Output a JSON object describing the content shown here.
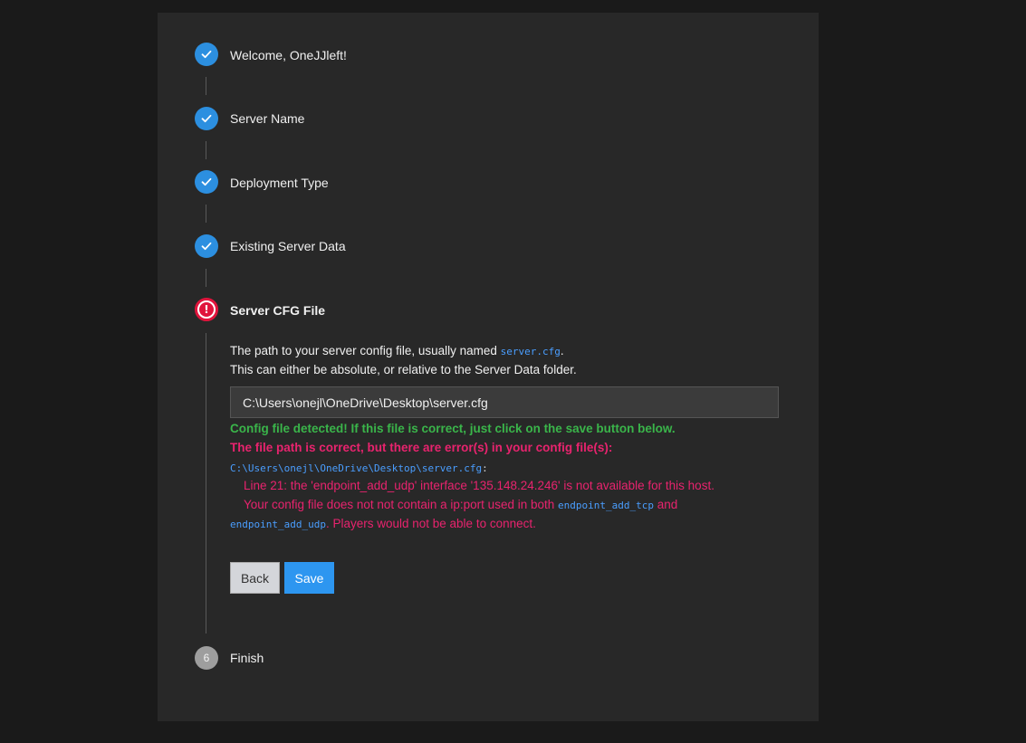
{
  "steps": [
    {
      "label": "Welcome, OneJJleft!",
      "status": "done"
    },
    {
      "label": "Server Name",
      "status": "done"
    },
    {
      "label": "Deployment Type",
      "status": "done"
    },
    {
      "label": "Existing Server Data",
      "status": "done"
    },
    {
      "label": "Server CFG File",
      "status": "error"
    },
    {
      "label": "Finish",
      "status": "pending",
      "number": "6"
    }
  ],
  "cfg": {
    "desc_prefix": "The path to your server config file, usually named ",
    "desc_code": "server.cfg",
    "desc_suffix": ".",
    "desc_line2": "This can either be absolute, or relative to the Server Data folder.",
    "path_value": "C:\\Users\\onejl\\OneDrive\\Desktop\\server.cfg",
    "ok_message": "Config file detected! If this file is correct, just click on the save button below.",
    "error_heading": "The file path is correct, but there are error(s) in your config file(s):",
    "error_file": "C:\\Users\\onejl\\OneDrive\\Desktop\\server.cfg",
    "error_file_suffix": ":",
    "error1": "Line 21: the 'endpoint_add_udp' interface '135.148.24.246' is not available for this host.",
    "error2_prefix": "Your config file does not not contain a ip:port used in both ",
    "error2_code1": "endpoint_add_tcp",
    "error2_mid": " and",
    "error2_code2": "endpoint_add_udp",
    "error2_suffix": ". Players would not be able to connect.",
    "back_label": "Back",
    "save_label": "Save"
  },
  "colors": {
    "done": "#2c8fe0",
    "error": "#e0143c",
    "ok_text": "#3ab54a",
    "error_text": "#e8236e",
    "code": "#4a9eff"
  },
  "icons": {
    "done": "checkmark-icon",
    "error": "exclamation-icon"
  }
}
